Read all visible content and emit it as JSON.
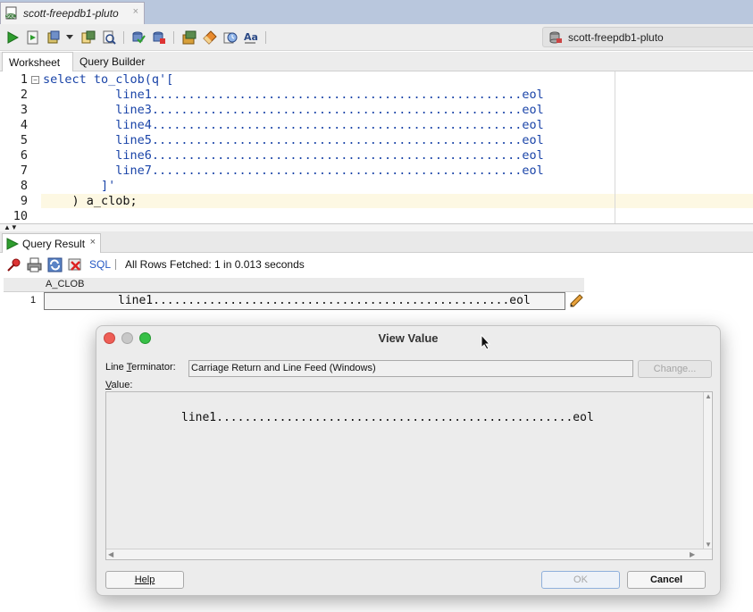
{
  "doc_tab": {
    "title": "scott-freepdb1-pluto",
    "close": "×"
  },
  "toolbar": {
    "connection": "scott-freepdb1-pluto"
  },
  "worksheet_tabs": [
    "Worksheet",
    "Query Builder"
  ],
  "editor": {
    "line_numbers": [
      "1",
      "2",
      "3",
      "4",
      "5",
      "6",
      "7",
      "8",
      "9",
      "10"
    ],
    "lines": [
      "select to_clob(q'[",
      "          line1...................................................eol",
      "          line3...................................................eol",
      "          line4...................................................eol",
      "          line5...................................................eol",
      "          line6...................................................eol",
      "          line7...................................................eol",
      "        ]'",
      "    ) a_clob;",
      ""
    ]
  },
  "result": {
    "tab_label": "Query Result",
    "tab_close": "×",
    "sql_link": "SQL",
    "status": "All Rows Fetched: 1 in 0.013 seconds",
    "column_header": "A_CLOB",
    "row_number": "1",
    "cell_value": "line1...................................................eol"
  },
  "dialog": {
    "title": "View Value",
    "line_terminator_label_pre": "Line ",
    "line_terminator_label_u": "T",
    "line_terminator_label_post": "erminator:",
    "line_terminator_value": "Carriage Return and Line Feed (Windows)",
    "change_button": "Change...",
    "value_label_u": "V",
    "value_label_post": "alue:",
    "value_text": "line1...................................................eol",
    "help_button": "Help",
    "ok_button": "OK",
    "cancel_button": "Cancel"
  },
  "colors": {
    "tab_bar": "#b9c7dd",
    "keyword": "#1a44a8",
    "highlight_line": "#fdf8e3",
    "sql_link": "#2458c4",
    "traffic_close": "#ee5e56",
    "traffic_min": "#c8c8c8",
    "traffic_zoom": "#37c047"
  }
}
